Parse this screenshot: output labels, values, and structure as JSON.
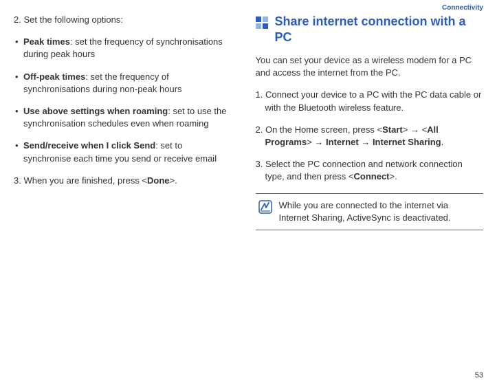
{
  "header": {
    "section": "Connectivity"
  },
  "pageNumber": "53",
  "left": {
    "step2_intro": "2. Set the following options:",
    "bullets": [
      {
        "term": "Peak times",
        "desc": ": set the frequency of synchronisations during peak hours"
      },
      {
        "term": "Off-peak times",
        "desc": ": set the frequency of synchronisations during non-peak hours"
      },
      {
        "term": "Use above settings when roaming",
        "desc": ": set to use the synchronisation schedules even when roaming"
      },
      {
        "term": "Send/receive when I click Send",
        "desc": ": set to synchronise each time you send or receive email"
      }
    ],
    "step3_pre": "3. When you are finished, press <",
    "step3_key": "Done",
    "step3_post": ">."
  },
  "right": {
    "heading": "Share internet connection with a PC",
    "intro": "You can set your device as a wireless modem for a PC and access the internet from the PC.",
    "step1": "1. Connect your device to a PC with the PC data cable or with the Bluetooth wireless feature.",
    "step2": {
      "t0": "2. On the Home screen, press <",
      "k0": "Start",
      "t1": "> → <",
      "k1": "All Programs",
      "t2": "> → ",
      "k2": "Internet",
      "t3": " → ",
      "k3": "Internet Sharing",
      "t4": "."
    },
    "step3": {
      "t0": "3. Select the PC connection and network connection type, and then press <",
      "k0": "Connect",
      "t1": ">."
    },
    "note": "While you are connected to the internet via Internet Sharing, ActiveSync is deactivated."
  }
}
